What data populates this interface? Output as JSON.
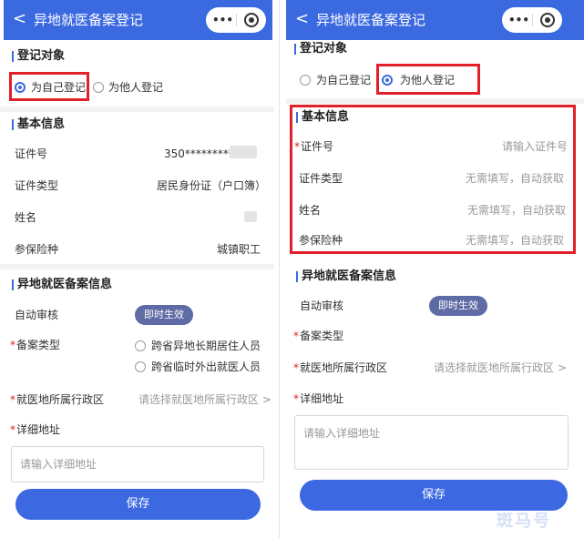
{
  "left": {
    "header": {
      "back": "<",
      "title": "异地就医备案登记",
      "more": "•••"
    },
    "register_target": {
      "title": "登记对象",
      "options": [
        {
          "label": "为自己登记",
          "selected": true
        },
        {
          "label": "为他人登记",
          "selected": false
        }
      ]
    },
    "basic": {
      "title": "基本信息",
      "rows": [
        {
          "label": "证件号",
          "value": "350*********"
        },
        {
          "label": "证件类型",
          "value": "居民身份证（户口簿）"
        },
        {
          "label": "姓名",
          "value": ""
        },
        {
          "label": "参保险种",
          "value": "城镇职工"
        }
      ]
    },
    "filing": {
      "title": "异地就医备案信息",
      "auto_review_label": "自动审核",
      "auto_review_value": "即时生效",
      "type_label": "备案类型",
      "type_options": [
        "跨省异地长期居住人员",
        "跨省临时外出就医人员"
      ],
      "region_label": "就医地所属行政区",
      "region_placeholder": "请选择就医地所属行政区 >",
      "address_label": "详细地址",
      "address_placeholder": "请输入详细地址"
    },
    "save_label": "保存"
  },
  "right": {
    "header": {
      "back": "<",
      "title": "异地就医备案登记",
      "more": "•••"
    },
    "register_target": {
      "title": "登记对象",
      "options": [
        {
          "label": "为自己登记",
          "selected": false
        },
        {
          "label": "为他人登记",
          "selected": true
        }
      ]
    },
    "basic": {
      "title": "基本信息",
      "rows": [
        {
          "label": "证件号",
          "placeholder": "请输入证件号",
          "required": true
        },
        {
          "label": "证件类型",
          "placeholder": "无需填写，自动获取",
          "required": false
        },
        {
          "label": "姓名",
          "placeholder": "无需填写，自动获取",
          "required": false
        },
        {
          "label": "参保险种",
          "placeholder": "无需填写，自动获取",
          "required": false
        }
      ]
    },
    "filing": {
      "title": "异地就医备案信息",
      "auto_review_label": "自动审核",
      "auto_review_value": "即时生效",
      "type_label": "备案类型",
      "region_label": "就医地所属行政区",
      "region_placeholder": "请选择就医地所属行政区 >",
      "address_label": "详细地址",
      "address_placeholder": "请输入详细地址"
    },
    "save_label": "保存"
  },
  "required_mark": "*",
  "watermark": "斑马号",
  "colors": {
    "primary": "#3b69e0",
    "highlight": "#e0202a",
    "pill": "#5f6ba4",
    "required": "#e0202a"
  },
  "icons": {
    "back": "chevron-left-icon",
    "more": "more-dots-icon",
    "close": "target-circle-icon"
  }
}
